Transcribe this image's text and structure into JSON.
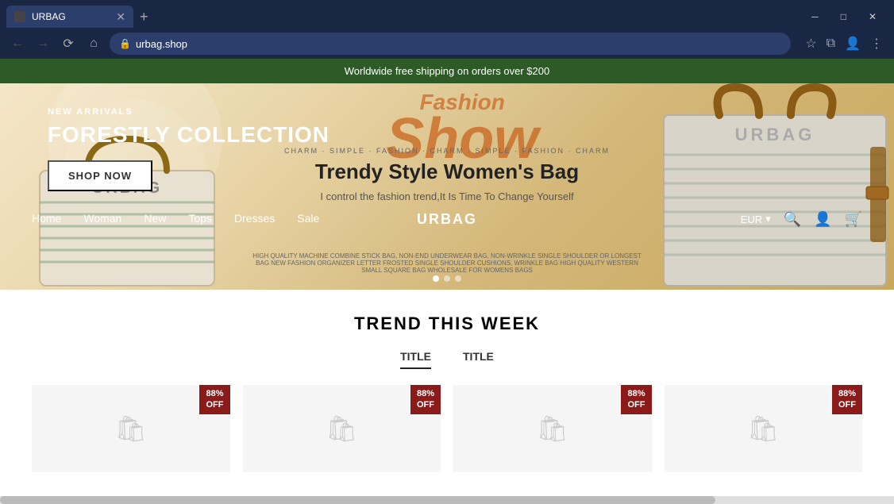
{
  "browser": {
    "tab_title": "URBAG",
    "url": "urbag.shop",
    "window_controls": [
      "minimize",
      "maximize",
      "close"
    ]
  },
  "banner": {
    "text": "Worldwide free shipping on orders over $200"
  },
  "nav": {
    "logo": "URBAG",
    "links": [
      "Home",
      "Woman",
      "New",
      "Tops",
      "Dresses",
      "Sale"
    ],
    "currency": "EUR",
    "icons": [
      "search",
      "account",
      "cart"
    ]
  },
  "hero": {
    "subtitle": "NEW ARRIVALS",
    "title": "FORESTLY COLLECTION",
    "fashion_top": "Fashion",
    "fashion_main": "Show",
    "charm_bar": "CHARM · SIMPLE · FASHION · CHARM · SIMPLE · FASHION · CHARM",
    "center_title": "Trendy Style Women's Bag",
    "center_sub": "I control the fashion trend,It Is Time To Change Yourself",
    "small_text": "HIGH QUALITY MACHINE COMBINE STICK BAG, NON-END UNDERWEAR BAG, NON-WRINKLE SINGLE SHOULDER OR LONGEST BAG NEW FASHION ORGANIZER LETTER FROSTED SINGLE SHOULDER CUSHIONS, WRINKLE BAG HIGH QUALITY WESTERN SMALL SQUARE BAG WHOLESALE FOR WOMENS BAGS",
    "shop_btn": "SHOP NOW",
    "dots": [
      true,
      false,
      false
    ]
  },
  "trend": {
    "section_title": "TREND THIS WEEK",
    "tabs": [
      "TITLE",
      "TITLE"
    ],
    "active_tab": 0,
    "products": [
      {
        "discount": "88%\nOFF"
      },
      {
        "discount": "88%\nOFF"
      },
      {
        "discount": "88%\nOFF"
      },
      {
        "discount": "88%\nOFF"
      }
    ]
  }
}
